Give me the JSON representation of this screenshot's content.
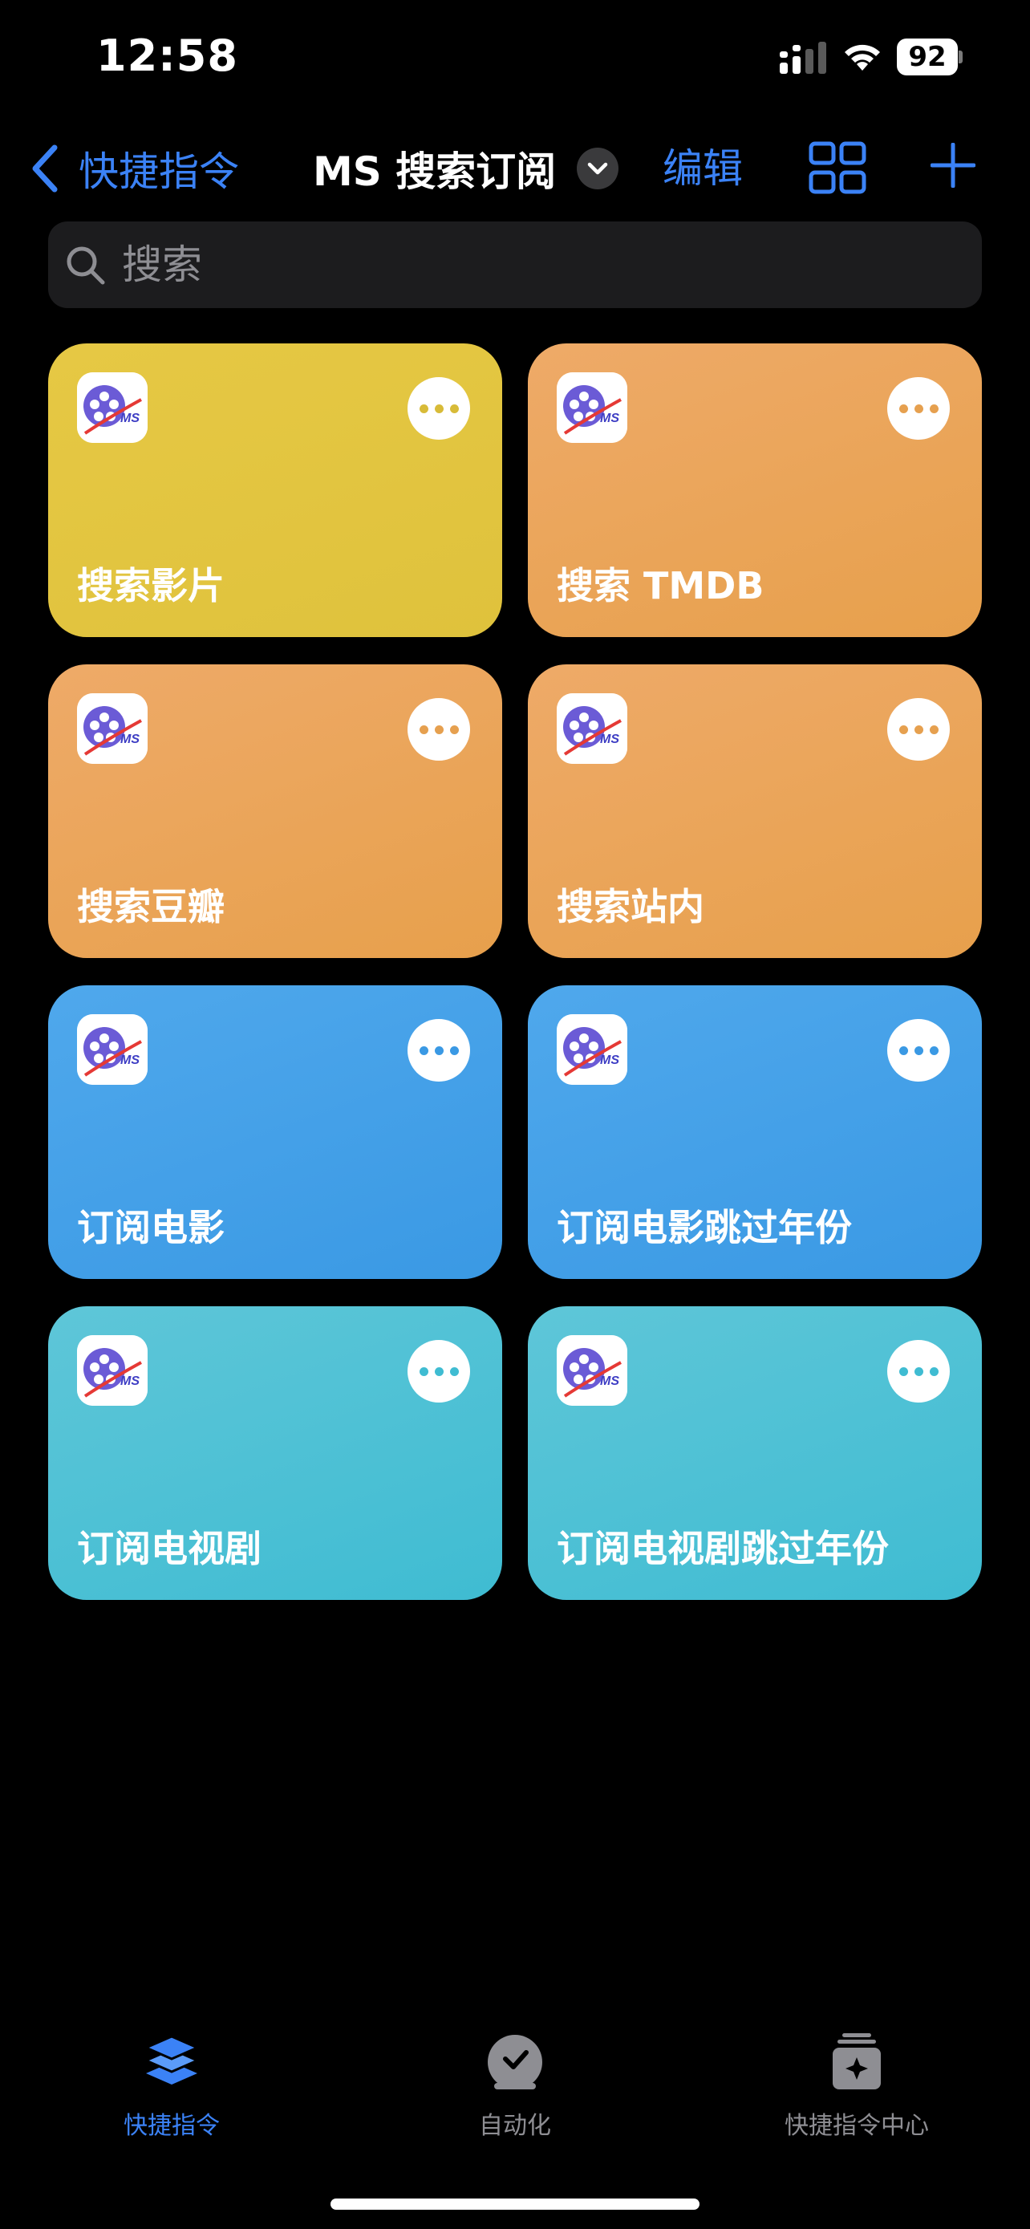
{
  "status_bar": {
    "time": "12:58",
    "battery": "92"
  },
  "nav": {
    "back_label": "快捷指令",
    "title": "MS 搜索订阅",
    "edit_label": "编辑"
  },
  "search": {
    "placeholder": "搜索"
  },
  "shortcuts": [
    {
      "label": "搜索影片",
      "color": "yellow"
    },
    {
      "label": "搜索 TMDB",
      "color": "orange"
    },
    {
      "label": "搜索豆瓣",
      "color": "orange"
    },
    {
      "label": "搜索站内",
      "color": "orange"
    },
    {
      "label": "订阅电影",
      "color": "blue"
    },
    {
      "label": "订阅电影跳过年份",
      "color": "blue"
    },
    {
      "label": "订阅电视剧",
      "color": "cyan"
    },
    {
      "label": "订阅电视剧跳过年份",
      "color": "cyan"
    }
  ],
  "colors": {
    "accent": "#3b82f6",
    "yellow": "#e3c640",
    "orange": "#eba65a",
    "blue": "#44a1e8",
    "cyan": "#4fc1d5"
  },
  "tabs": [
    {
      "label": "快捷指令",
      "icon": "stack-icon",
      "active": true
    },
    {
      "label": "自动化",
      "icon": "automation-check-icon",
      "active": false
    },
    {
      "label": "快捷指令中心",
      "icon": "gallery-sparkle-icon",
      "active": false
    }
  ]
}
